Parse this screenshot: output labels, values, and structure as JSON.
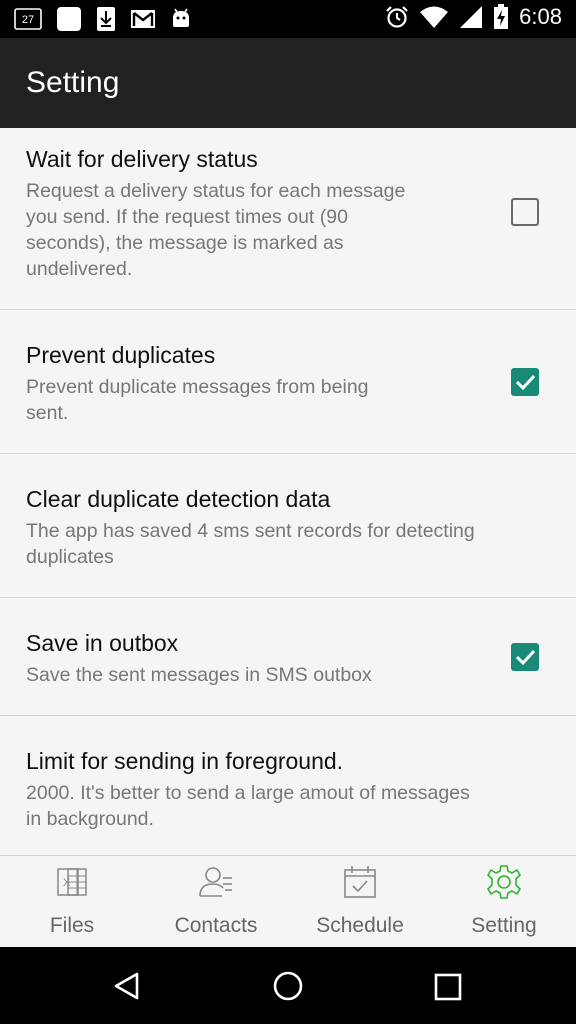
{
  "status_bar": {
    "notification_count": "27",
    "time": "6:08"
  },
  "app_bar": {
    "title": "Setting"
  },
  "preferences": [
    {
      "title": "Wait for delivery status",
      "summary_lines": [
        "Request a delivery status for each message",
        "you send. If the request times out (90",
        "seconds), the message is marked as",
        "undelivered."
      ],
      "checked": false
    },
    {
      "title": "Prevent duplicates",
      "summary_lines": [
        "Prevent duplicate messages from being",
        "sent."
      ],
      "checked": true
    },
    {
      "title": "Clear duplicate detection data",
      "summary_lines": [
        "The app has saved 4 sms sent records for detecting",
        "duplicates"
      ]
    },
    {
      "title": "Save in outbox",
      "summary_lines": [
        "Save the sent messages in SMS outbox"
      ],
      "checked": true
    },
    {
      "title": "Limit for sending in foreground.",
      "summary_lines": [
        "2000. It's better to send a large amout of messages",
        "in background."
      ]
    }
  ],
  "bottom_nav": {
    "items": [
      {
        "label": "Files",
        "icon": "excel-file-icon"
      },
      {
        "label": "Contacts",
        "icon": "contacts-icon"
      },
      {
        "label": "Schedule",
        "icon": "calendar-check-icon"
      },
      {
        "label": "Setting",
        "icon": "gear-icon",
        "active": true
      }
    ]
  },
  "colors": {
    "accent": "#1a8a78",
    "app_bar": "#212121",
    "active_nav_icon": "#2fb52f"
  },
  "icons": {
    "status_left": [
      "notification-count-icon",
      "square-notification-icon",
      "download-icon",
      "gmail-icon",
      "android-icon"
    ],
    "status_right": [
      "alarm-icon",
      "wifi-icon",
      "signal-icon",
      "battery-charging-icon"
    ],
    "system_nav": [
      "back-icon",
      "home-icon",
      "recents-icon"
    ]
  }
}
